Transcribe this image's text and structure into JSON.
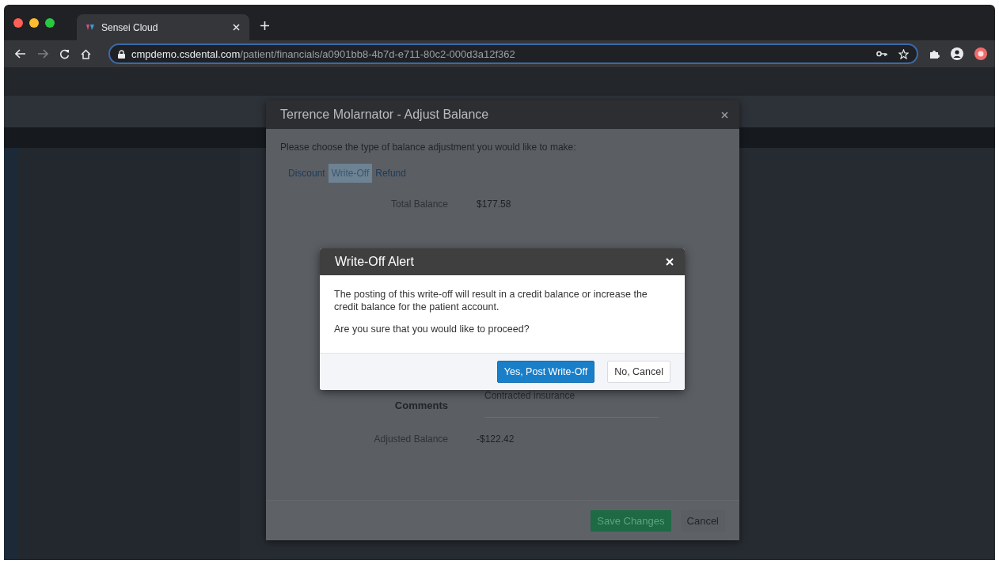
{
  "browser": {
    "tab_title": "Sensei Cloud",
    "url_host": "cmpdemo.csdental.com",
    "url_path": "/patient/financials/a0901bb8-4b7d-e711-80c2-000d3a12f362"
  },
  "adjust_modal": {
    "title": "Terrence Molarnator - Adjust Balance",
    "prompt": "Please choose the type of balance adjustment you would like to make:",
    "tabs": [
      {
        "label": "Discount",
        "selected": false
      },
      {
        "label": "Write-Off",
        "selected": true
      },
      {
        "label": "Refund",
        "selected": false
      }
    ],
    "fields": [
      {
        "kind": "amount",
        "label": "Total Balance",
        "value": "$177.58"
      },
      {
        "kind": "textarea",
        "label": "Comments",
        "value": "Contracted insurance"
      },
      {
        "kind": "amount",
        "label": "Adjusted Balance",
        "value": "-$122.42"
      }
    ],
    "buttons": [
      {
        "kind": "primary",
        "label": "Save Changes"
      },
      {
        "kind": "secondary",
        "label": "Cancel"
      }
    ]
  },
  "alert": {
    "title": "Write-Off Alert",
    "messages": [
      "The posting of this write-off will result in a credit balance or increase the credit balance for the patient account.",
      "Are you sure that you would like to proceed?"
    ],
    "buttons": [
      {
        "kind": "primary",
        "label": "Yes, Post Write-Off"
      },
      {
        "kind": "secondary",
        "label": "No, Cancel"
      }
    ]
  }
}
